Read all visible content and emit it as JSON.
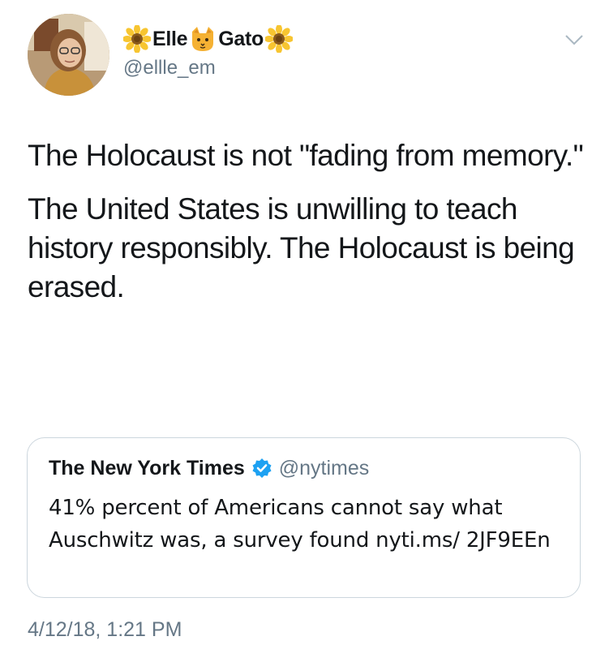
{
  "author": {
    "name_part1": "Elle",
    "name_part2": "Gato",
    "handle": "@ellle_em",
    "name_emojis": [
      "sunflower-icon",
      "cat-face-icon",
      "sunflower-icon"
    ]
  },
  "tweet": {
    "paragraph1": "The Holocaust is not \"fading from memory.\"",
    "paragraph2": "The United States is unwilling to teach history responsibly. The Holocaust is being erased.",
    "timestamp": "4/12/18, 1:21 PM"
  },
  "quoted_tweet": {
    "name": "The New York Times",
    "handle": "@nytimes",
    "text": "41% percent of Americans cannot say what Auschwitz was, a survey found nyti.ms/ 2JF9EEn",
    "verified_icon": "verified-badge-icon"
  },
  "colors": {
    "text": "#14171a",
    "secondary": "#657786",
    "border": "#ccd6dd",
    "verified": "#1da1f2"
  }
}
